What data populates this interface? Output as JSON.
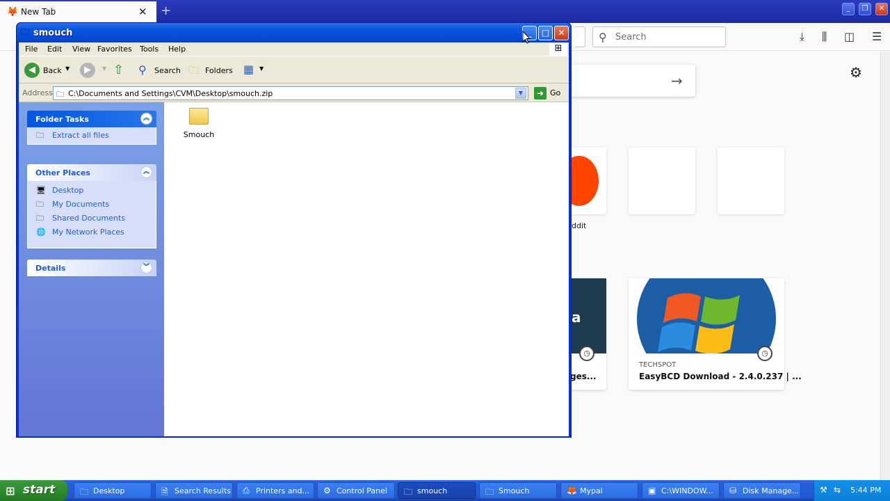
{
  "browser": {
    "tab_title": "New Tab",
    "search_placeholder": "Search",
    "reddit_label": "ddit",
    "highlight1_title": "ges...",
    "highlight1_letter": "a",
    "highlight2_source": "TECHSPOT",
    "highlight2_title": "EasyBCD Download - 2.4.0.237 | ..."
  },
  "window": {
    "title": "smouch",
    "menu": [
      "File",
      "Edit",
      "View",
      "Favorites",
      "Tools",
      "Help"
    ],
    "toolbar": {
      "back": "Back",
      "search": "Search",
      "folders": "Folders"
    },
    "address": {
      "label": "Address",
      "value": "C:\\Documents and Settings\\CVM\\Desktop\\smouch.zip",
      "go": "Go"
    },
    "panels": {
      "folder_tasks": {
        "title": "Folder Tasks",
        "items": [
          "Extract all files"
        ]
      },
      "other_places": {
        "title": "Other Places",
        "items": [
          "Desktop",
          "My Documents",
          "Shared Documents",
          "My Network Places"
        ]
      },
      "details": {
        "title": "Details"
      }
    },
    "items": [
      {
        "label": "Smouch",
        "icon": "folder-icon"
      }
    ]
  },
  "taskbar": {
    "start": "start",
    "buttons": [
      {
        "label": "Desktop",
        "icon": "folder-icon",
        "active": false
      },
      {
        "label": "Search Results",
        "icon": "search-results-icon",
        "active": false
      },
      {
        "label": "Printers and...",
        "icon": "printer-icon",
        "active": false
      },
      {
        "label": "Control Panel",
        "icon": "control-panel-icon",
        "active": false
      },
      {
        "label": "smouch",
        "icon": "zip-folder-icon",
        "active": true
      },
      {
        "label": "Smouch",
        "icon": "folder-icon",
        "active": false
      },
      {
        "label": "Mypal",
        "icon": "browser-icon",
        "active": false
      },
      {
        "label": "C:\\WINDOW...",
        "icon": "cmd-icon",
        "active": false
      },
      {
        "label": "Disk Manage...",
        "icon": "disk-management-icon",
        "active": false
      }
    ],
    "clock": "5:44 PM"
  },
  "colors": {
    "xp_blue": "#0831d9",
    "taskbar": "#245edb",
    "start_green": "#3c9b3c",
    "panel_link": "#215dc6",
    "reddit": "#ff4500"
  }
}
